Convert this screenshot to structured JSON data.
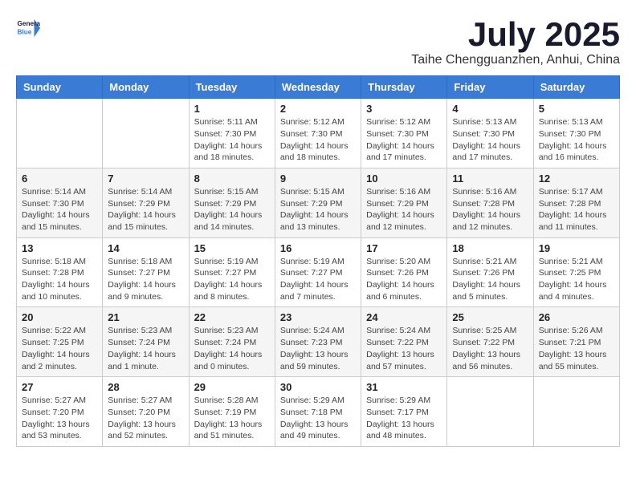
{
  "logo": {
    "line1": "General",
    "line2": "Blue"
  },
  "title": "July 2025",
  "location": "Taihe Chengguanzhen, Anhui, China",
  "weekdays": [
    "Sunday",
    "Monday",
    "Tuesday",
    "Wednesday",
    "Thursday",
    "Friday",
    "Saturday"
  ],
  "weeks": [
    [
      {
        "day": "",
        "info": ""
      },
      {
        "day": "",
        "info": ""
      },
      {
        "day": "1",
        "info": "Sunrise: 5:11 AM\nSunset: 7:30 PM\nDaylight: 14 hours and 18 minutes."
      },
      {
        "day": "2",
        "info": "Sunrise: 5:12 AM\nSunset: 7:30 PM\nDaylight: 14 hours and 18 minutes."
      },
      {
        "day": "3",
        "info": "Sunrise: 5:12 AM\nSunset: 7:30 PM\nDaylight: 14 hours and 17 minutes."
      },
      {
        "day": "4",
        "info": "Sunrise: 5:13 AM\nSunset: 7:30 PM\nDaylight: 14 hours and 17 minutes."
      },
      {
        "day": "5",
        "info": "Sunrise: 5:13 AM\nSunset: 7:30 PM\nDaylight: 14 hours and 16 minutes."
      }
    ],
    [
      {
        "day": "6",
        "info": "Sunrise: 5:14 AM\nSunset: 7:30 PM\nDaylight: 14 hours and 15 minutes."
      },
      {
        "day": "7",
        "info": "Sunrise: 5:14 AM\nSunset: 7:29 PM\nDaylight: 14 hours and 15 minutes."
      },
      {
        "day": "8",
        "info": "Sunrise: 5:15 AM\nSunset: 7:29 PM\nDaylight: 14 hours and 14 minutes."
      },
      {
        "day": "9",
        "info": "Sunrise: 5:15 AM\nSunset: 7:29 PM\nDaylight: 14 hours and 13 minutes."
      },
      {
        "day": "10",
        "info": "Sunrise: 5:16 AM\nSunset: 7:29 PM\nDaylight: 14 hours and 12 minutes."
      },
      {
        "day": "11",
        "info": "Sunrise: 5:16 AM\nSunset: 7:28 PM\nDaylight: 14 hours and 12 minutes."
      },
      {
        "day": "12",
        "info": "Sunrise: 5:17 AM\nSunset: 7:28 PM\nDaylight: 14 hours and 11 minutes."
      }
    ],
    [
      {
        "day": "13",
        "info": "Sunrise: 5:18 AM\nSunset: 7:28 PM\nDaylight: 14 hours and 10 minutes."
      },
      {
        "day": "14",
        "info": "Sunrise: 5:18 AM\nSunset: 7:27 PM\nDaylight: 14 hours and 9 minutes."
      },
      {
        "day": "15",
        "info": "Sunrise: 5:19 AM\nSunset: 7:27 PM\nDaylight: 14 hours and 8 minutes."
      },
      {
        "day": "16",
        "info": "Sunrise: 5:19 AM\nSunset: 7:27 PM\nDaylight: 14 hours and 7 minutes."
      },
      {
        "day": "17",
        "info": "Sunrise: 5:20 AM\nSunset: 7:26 PM\nDaylight: 14 hours and 6 minutes."
      },
      {
        "day": "18",
        "info": "Sunrise: 5:21 AM\nSunset: 7:26 PM\nDaylight: 14 hours and 5 minutes."
      },
      {
        "day": "19",
        "info": "Sunrise: 5:21 AM\nSunset: 7:25 PM\nDaylight: 14 hours and 4 minutes."
      }
    ],
    [
      {
        "day": "20",
        "info": "Sunrise: 5:22 AM\nSunset: 7:25 PM\nDaylight: 14 hours and 2 minutes."
      },
      {
        "day": "21",
        "info": "Sunrise: 5:23 AM\nSunset: 7:24 PM\nDaylight: 14 hours and 1 minute."
      },
      {
        "day": "22",
        "info": "Sunrise: 5:23 AM\nSunset: 7:24 PM\nDaylight: 14 hours and 0 minutes."
      },
      {
        "day": "23",
        "info": "Sunrise: 5:24 AM\nSunset: 7:23 PM\nDaylight: 13 hours and 59 minutes."
      },
      {
        "day": "24",
        "info": "Sunrise: 5:24 AM\nSunset: 7:22 PM\nDaylight: 13 hours and 57 minutes."
      },
      {
        "day": "25",
        "info": "Sunrise: 5:25 AM\nSunset: 7:22 PM\nDaylight: 13 hours and 56 minutes."
      },
      {
        "day": "26",
        "info": "Sunrise: 5:26 AM\nSunset: 7:21 PM\nDaylight: 13 hours and 55 minutes."
      }
    ],
    [
      {
        "day": "27",
        "info": "Sunrise: 5:27 AM\nSunset: 7:20 PM\nDaylight: 13 hours and 53 minutes."
      },
      {
        "day": "28",
        "info": "Sunrise: 5:27 AM\nSunset: 7:20 PM\nDaylight: 13 hours and 52 minutes."
      },
      {
        "day": "29",
        "info": "Sunrise: 5:28 AM\nSunset: 7:19 PM\nDaylight: 13 hours and 51 minutes."
      },
      {
        "day": "30",
        "info": "Sunrise: 5:29 AM\nSunset: 7:18 PM\nDaylight: 13 hours and 49 minutes."
      },
      {
        "day": "31",
        "info": "Sunrise: 5:29 AM\nSunset: 7:17 PM\nDaylight: 13 hours and 48 minutes."
      },
      {
        "day": "",
        "info": ""
      },
      {
        "day": "",
        "info": ""
      }
    ]
  ]
}
